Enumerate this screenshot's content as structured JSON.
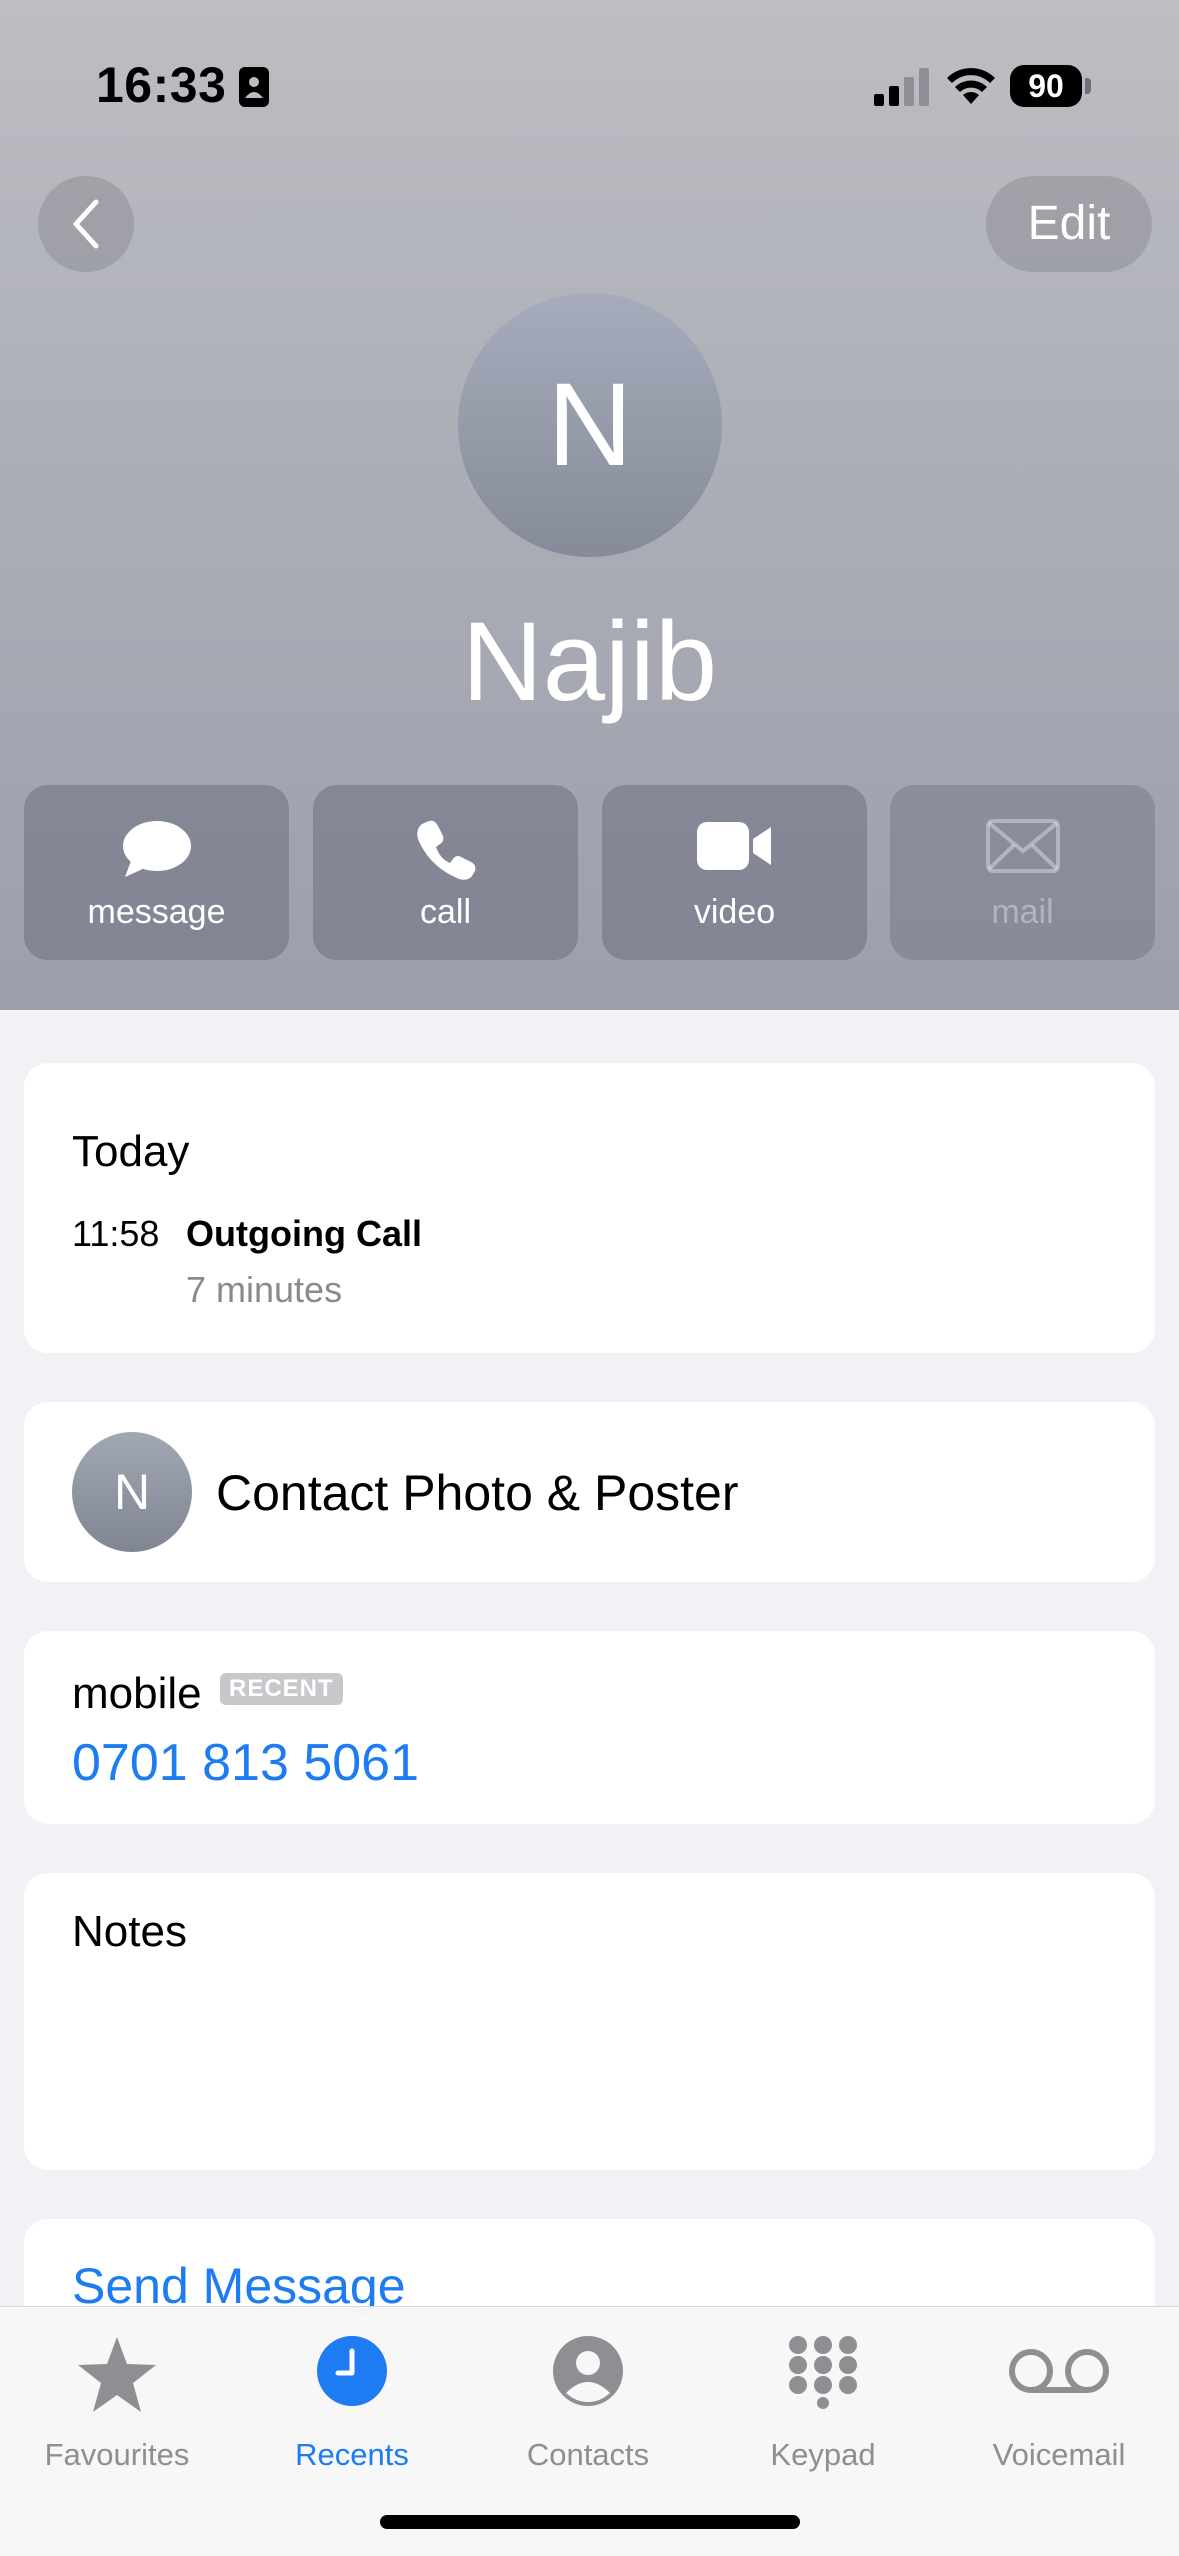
{
  "status_bar": {
    "time": "16:33",
    "battery": "90",
    "icons": [
      "contact-card-icon",
      "signal-icon",
      "wifi-icon",
      "battery-icon"
    ]
  },
  "header": {
    "edit_label": "Edit",
    "avatar_initial": "N",
    "name": "Najib",
    "colors": {
      "background": "#a9abb5",
      "avatar": "#8e93a1"
    }
  },
  "actions": [
    {
      "label": "message",
      "icon": "message-icon",
      "enabled": true
    },
    {
      "label": "call",
      "icon": "phone-icon",
      "enabled": true
    },
    {
      "label": "video",
      "icon": "video-icon",
      "enabled": true
    },
    {
      "label": "mail",
      "icon": "mail-icon",
      "enabled": false
    }
  ],
  "recents": {
    "day": "Today",
    "time": "11:58",
    "type": "Outgoing Call",
    "duration": "7 minutes"
  },
  "contact_photo": {
    "initial": "N",
    "label": "Contact Photo & Poster"
  },
  "phone": {
    "label": "mobile",
    "badge": "RECENT",
    "number": "0701 813 5061"
  },
  "notes": {
    "label": "Notes"
  },
  "send_message": {
    "label": "Send Message"
  },
  "tab_bar": {
    "active": "Recents",
    "accent": "#1d7cf2",
    "tabs": [
      {
        "label": "Favourites",
        "icon": "star-icon"
      },
      {
        "label": "Recents",
        "icon": "clock-icon"
      },
      {
        "label": "Contacts",
        "icon": "person-circle-icon"
      },
      {
        "label": "Keypad",
        "icon": "keypad-icon"
      },
      {
        "label": "Voicemail",
        "icon": "voicemail-icon"
      }
    ]
  }
}
